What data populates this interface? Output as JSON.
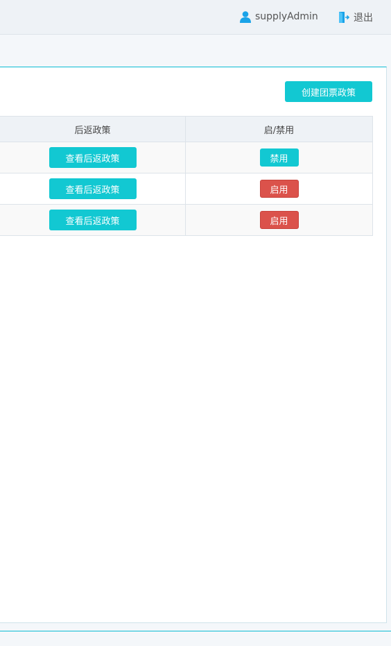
{
  "header": {
    "username": "supplyAdmin",
    "logout_label": "退出"
  },
  "toolbar": {
    "create_label": "创建团票政策"
  },
  "table": {
    "columns": [
      "后返政策",
      "启/禁用"
    ],
    "rows": [
      {
        "view_label": "查看后返政策",
        "toggle_label": "禁用",
        "toggle_state": "disable"
      },
      {
        "view_label": "查看后返政策",
        "toggle_label": "启用",
        "toggle_state": "enable"
      },
      {
        "view_label": "查看后返政策",
        "toggle_label": "启用",
        "toggle_state": "enable"
      }
    ]
  },
  "colors": {
    "accent": "#12c8d2",
    "danger": "#db524b",
    "user_icon": "#1aa3e8"
  },
  "icons": {
    "user": "user-icon",
    "logout": "logout-icon"
  }
}
